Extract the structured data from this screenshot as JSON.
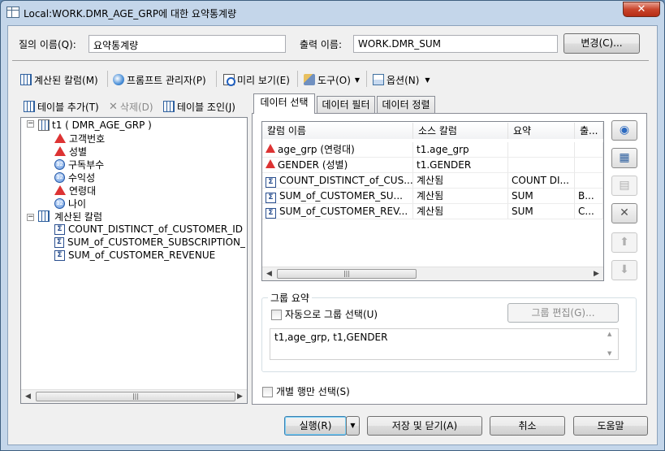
{
  "window": {
    "title": "Local:WORK.DMR_AGE_GRP에 대한 요약통계량",
    "close_label": "✕"
  },
  "query": {
    "name_label": "질의 이름(Q):",
    "name_value": "요약통계량",
    "output_label": "출력 이름:",
    "output_value": "WORK.DMR_SUM",
    "change_button": "변경(C)..."
  },
  "toolbar": {
    "computed_columns": "계산된 칼럼(M)",
    "prompt_manager": "프롬프트 관리자(P)",
    "preview": "미리 보기(E)",
    "tools": "도구(O)",
    "options": "옵션(N)"
  },
  "left_panel": {
    "add_table": "테이블 추가(T)",
    "delete": "삭제(D)",
    "join_tables": "테이블 조인(J)",
    "tree": {
      "table_label": "t1 ( DMR_AGE_GRP )",
      "columns": [
        {
          "label": "고객번호",
          "type": "char"
        },
        {
          "label": "성별",
          "type": "char"
        },
        {
          "label": "구독부수",
          "type": "num"
        },
        {
          "label": "수익성",
          "type": "num"
        },
        {
          "label": "연령대",
          "type": "char"
        },
        {
          "label": "나이",
          "type": "num"
        }
      ],
      "computed_label": "계산된 칼럼",
      "computed_items": [
        "COUNT_DISTINCT_of_CUSTOMER_ID",
        "SUM_of_CUSTOMER_SUBSCRIPTION_",
        "SUM_of_CUSTOMER_REVENUE"
      ]
    }
  },
  "tabs": [
    "데이터 선택",
    "데이터 필터",
    "데이터 정렬"
  ],
  "grid": {
    "headers": [
      "칼럼 이름",
      "소스 칼럼",
      "요약",
      "출..."
    ],
    "rows": [
      {
        "icon": "char",
        "name": "age_grp (연령대)",
        "source": "t1.age_grp",
        "summary": "",
        "out": ""
      },
      {
        "icon": "char",
        "name": "GENDER (성별)",
        "source": "t1.GENDER",
        "summary": "",
        "out": ""
      },
      {
        "icon": "sum",
        "name": "COUNT_DISTINCT_of_CUS...",
        "source": "계산됨",
        "summary": "COUNT DI...",
        "out": ""
      },
      {
        "icon": "sum",
        "name": "SUM_of_CUSTOMER_SU...",
        "source": "계산됨",
        "summary": "SUM",
        "out": "B..."
      },
      {
        "icon": "sum",
        "name": "SUM_of_CUSTOMER_REV...",
        "source": "계산됨",
        "summary": "SUM",
        "out": "C..."
      }
    ]
  },
  "group_summary": {
    "title": "그룹 요약",
    "auto_select": "자동으로 그룹 선택(U)",
    "edit_group": "그룹 편집(G)...",
    "group_value": "t1,age_grp, t1,GENDER"
  },
  "distinct_rows": "개별 행만 선택(S)",
  "footer": {
    "run": "실행(R)",
    "save_close": "저장 및 닫기(A)",
    "cancel": "취소",
    "help": "도움말"
  }
}
